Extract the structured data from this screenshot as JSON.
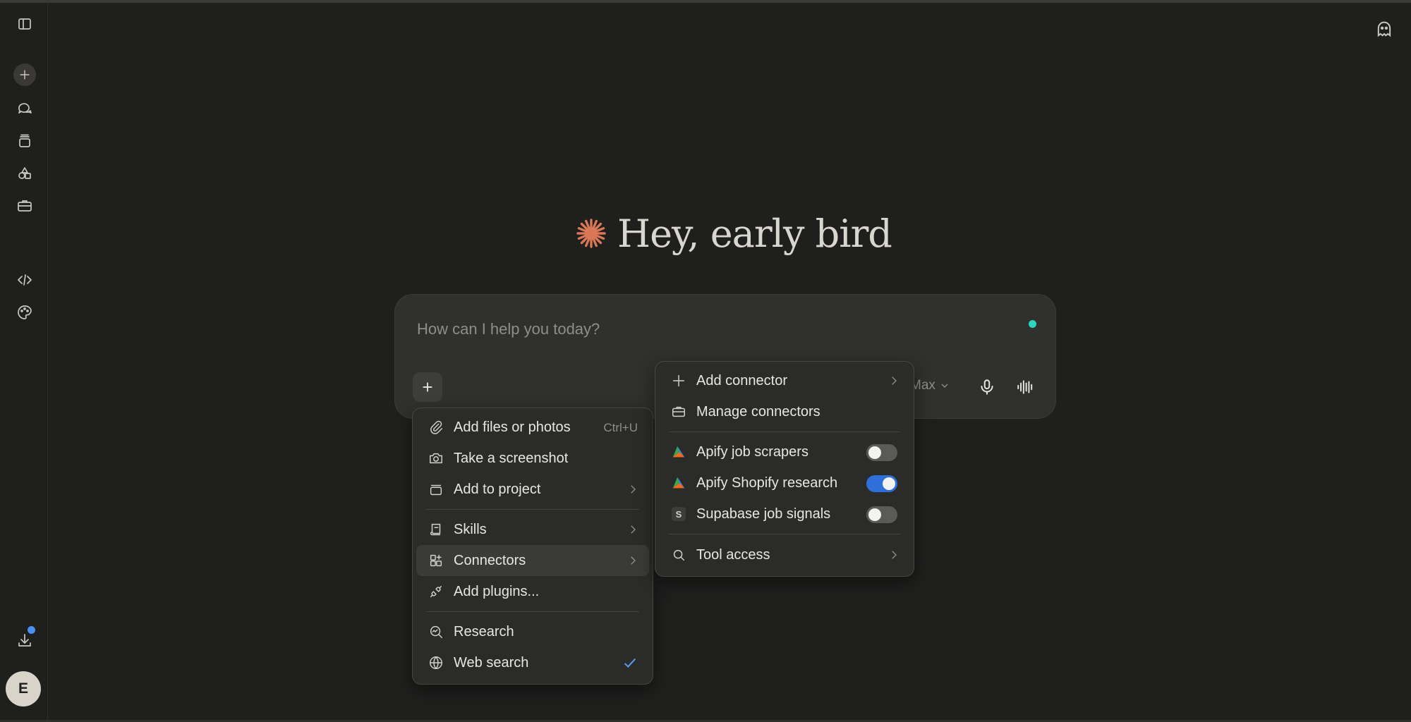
{
  "greeting": {
    "text": "Hey, early bird",
    "accent_color": "#d97757"
  },
  "composer": {
    "placeholder": "How can I help you today?",
    "model_label": "Max",
    "status_color": "#2dd4bf"
  },
  "sidebar": {
    "items": [
      "sidebar-toggle",
      "new-chat",
      "chats",
      "projects",
      "artifacts",
      "tools",
      "code",
      "customize"
    ],
    "avatar_initial": "E",
    "notification_color": "#4a8ff0"
  },
  "attach_menu": {
    "items": [
      {
        "label": "Add files or photos",
        "shortcut": "Ctrl+U",
        "icon": "paperclip-icon"
      },
      {
        "label": "Take a screenshot",
        "icon": "camera-icon"
      },
      {
        "label": "Add to project",
        "icon": "project-icon",
        "has_submenu": true
      },
      {
        "label": "Skills",
        "icon": "skills-icon",
        "has_submenu": true
      },
      {
        "label": "Connectors",
        "icon": "connectors-icon",
        "has_submenu": true,
        "active": true
      },
      {
        "label": "Add plugins...",
        "icon": "plug-icon"
      },
      {
        "label": "Research",
        "icon": "research-icon"
      },
      {
        "label": "Web search",
        "icon": "globe-icon",
        "checked": true
      }
    ]
  },
  "connectors_menu": {
    "items": [
      {
        "label": "Add connector",
        "icon": "plus-icon",
        "has_submenu": true
      },
      {
        "label": "Manage connectors",
        "icon": "briefcase-icon"
      },
      {
        "label": "Apify job scrapers",
        "icon": "apify-icon",
        "enabled": false
      },
      {
        "label": "Apify Shopify research",
        "icon": "apify-icon",
        "enabled": true
      },
      {
        "label": "Supabase job signals",
        "icon": "s-badge-icon",
        "badge": "S",
        "enabled": false
      },
      {
        "label": "Tool access",
        "icon": "search-icon",
        "has_submenu": true
      }
    ],
    "toggle_on_color": "#2f6fd9"
  }
}
